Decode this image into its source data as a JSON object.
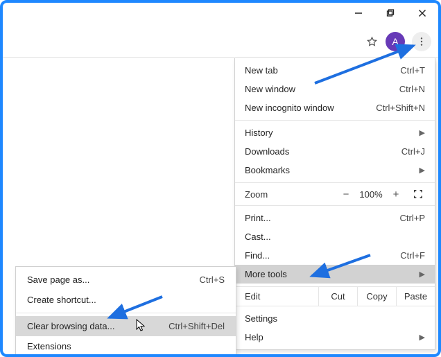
{
  "window": {
    "minimize": "Minimize",
    "maximize": "Maximize",
    "close": "Close"
  },
  "toolbar": {
    "star_name": "bookmark-star-icon",
    "avatar_letter": "A",
    "kebab_name": "chrome-menu-button"
  },
  "menu": {
    "new_tab": {
      "label": "New tab",
      "shortcut": "Ctrl+T"
    },
    "new_window": {
      "label": "New window",
      "shortcut": "Ctrl+N"
    },
    "new_incognito": {
      "label": "New incognito window",
      "shortcut": "Ctrl+Shift+N"
    },
    "history": {
      "label": "History"
    },
    "downloads": {
      "label": "Downloads",
      "shortcut": "Ctrl+J"
    },
    "bookmarks": {
      "label": "Bookmarks"
    },
    "zoom": {
      "label": "Zoom",
      "minus": "−",
      "value": "100%",
      "plus": "+"
    },
    "print": {
      "label": "Print...",
      "shortcut": "Ctrl+P"
    },
    "cast": {
      "label": "Cast..."
    },
    "find": {
      "label": "Find...",
      "shortcut": "Ctrl+F"
    },
    "more_tools": {
      "label": "More tools"
    },
    "edit": {
      "label": "Edit",
      "cut": "Cut",
      "copy": "Copy",
      "paste": "Paste"
    },
    "settings": {
      "label": "Settings"
    },
    "help": {
      "label": "Help"
    }
  },
  "submenu": {
    "save_page": {
      "label": "Save page as...",
      "shortcut": "Ctrl+S"
    },
    "create_shortcut": {
      "label": "Create shortcut..."
    },
    "clear_data": {
      "label": "Clear browsing data...",
      "shortcut": "Ctrl+Shift+Del"
    },
    "extensions": {
      "label": "Extensions"
    }
  }
}
